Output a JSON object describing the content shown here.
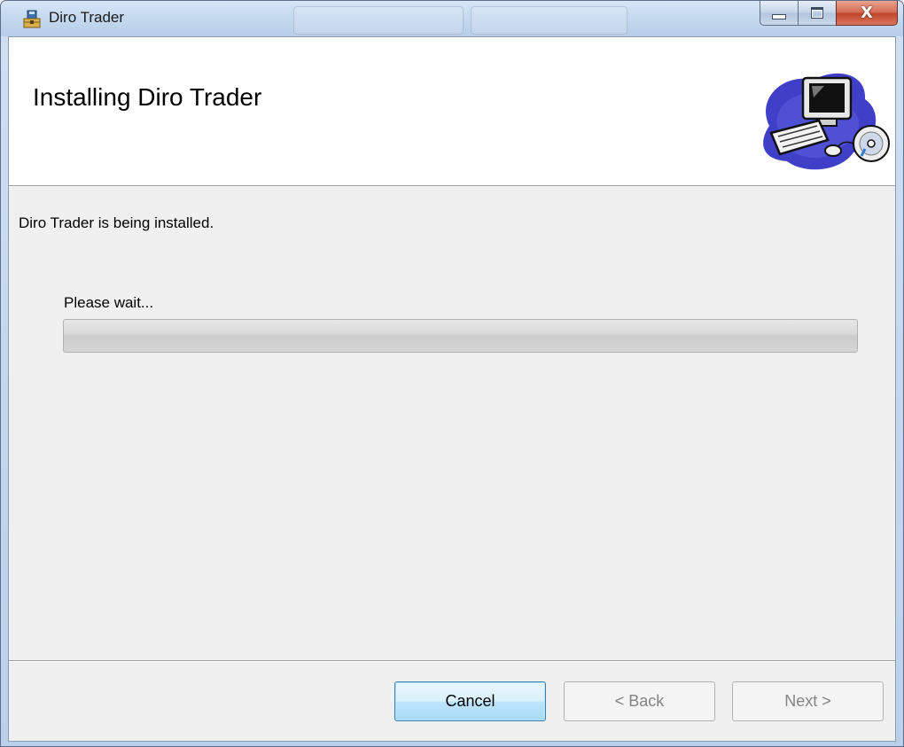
{
  "window": {
    "title": "Diro Trader"
  },
  "caption_buttons": {
    "close_label": "X"
  },
  "banner": {
    "title": "Installing Diro Trader",
    "art_icon": "computer-cd-clipart"
  },
  "body": {
    "status_text": "Diro Trader is being installed.",
    "wait_text": "Please wait...",
    "progress_fraction": 0
  },
  "buttons": {
    "cancel_label": "Cancel",
    "back_label": "< Back",
    "next_label": "Next >",
    "back_enabled": false,
    "next_enabled": false
  },
  "colors": {
    "accent": "#3c7fb1",
    "close_red": "#c2442a"
  }
}
